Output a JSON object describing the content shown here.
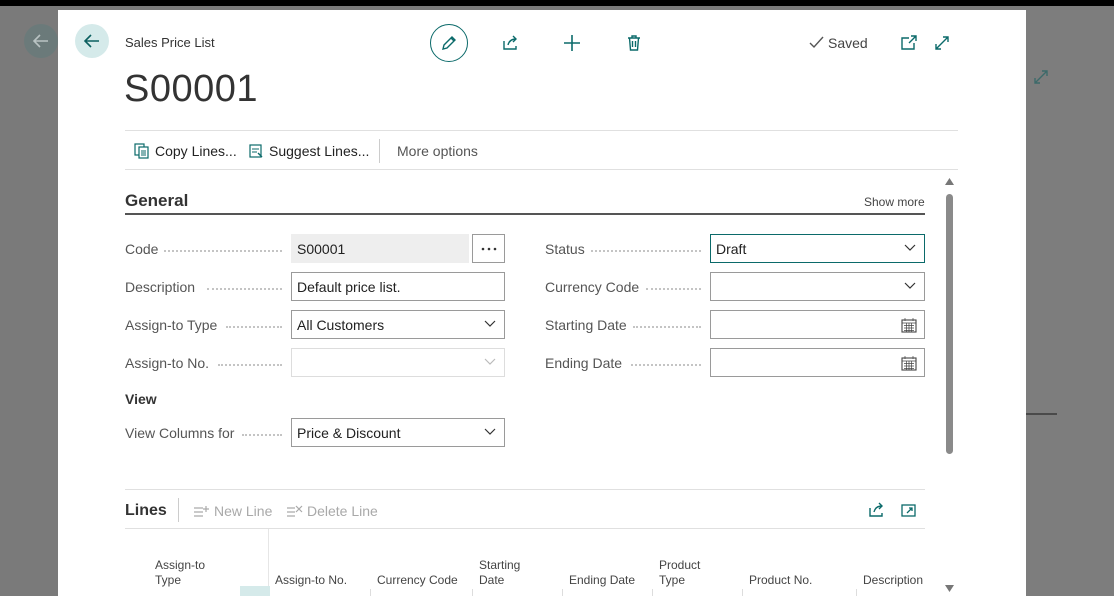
{
  "breadcrumb": "Sales Price List",
  "page_title": "S00001",
  "status_saved": "Saved",
  "actions": {
    "copy_lines": "Copy Lines...",
    "suggest_lines": "Suggest Lines...",
    "more_options": "More options"
  },
  "general": {
    "title": "General",
    "show_more": "Show more",
    "code": {
      "label": "Code",
      "value": "S00001"
    },
    "description": {
      "label": "Description",
      "value": "Default price list."
    },
    "assign_to_type": {
      "label": "Assign-to Type",
      "value": "All Customers"
    },
    "assign_to_no": {
      "label": "Assign-to No.",
      "value": ""
    },
    "status": {
      "label": "Status",
      "value": "Draft"
    },
    "currency_code": {
      "label": "Currency Code",
      "value": ""
    },
    "starting_date": {
      "label": "Starting Date",
      "value": ""
    },
    "ending_date": {
      "label": "Ending Date",
      "value": ""
    },
    "view_group": "View",
    "view_columns_for": {
      "label": "View Columns for",
      "value": "Price & Discount"
    }
  },
  "lines": {
    "title": "Lines",
    "new_line": "New Line",
    "delete_line": "Delete Line",
    "columns": [
      {
        "line1": "Assign-to",
        "line2": "Type"
      },
      {
        "line1": "",
        "line2": "Assign-to No."
      },
      {
        "line1": "",
        "line2": "Currency Code"
      },
      {
        "line1": "Starting",
        "line2": "Date"
      },
      {
        "line1": "",
        "line2": "Ending Date"
      },
      {
        "line1": "Product",
        "line2": "Type"
      },
      {
        "line1": "",
        "line2": "Product No."
      },
      {
        "line1": "",
        "line2": "Description"
      }
    ]
  },
  "colors": {
    "accent": "#0b6a6a",
    "background_overlay": "#7a7a7a"
  }
}
